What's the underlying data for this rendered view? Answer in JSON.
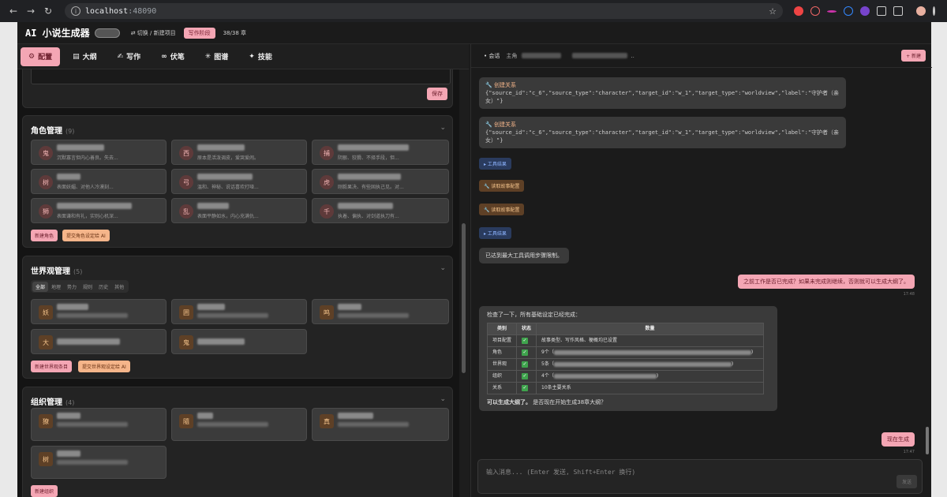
{
  "browser": {
    "url_host": "localhost",
    "url_port": ":48090"
  },
  "header": {
    "title": "AI 小说生成器",
    "switch_project": "⇄ 切换 / 新建项目",
    "phase_badge": "写作阶段",
    "chapter_count": "38/38 章"
  },
  "tabs": [
    {
      "label": "配置",
      "icon": "gear-icon"
    },
    {
      "label": "大纲",
      "icon": "outline-icon"
    },
    {
      "label": "写作",
      "icon": "pen-icon"
    },
    {
      "label": "伏笔",
      "icon": "link-icon"
    },
    {
      "label": "图谱",
      "icon": "graph-icon"
    },
    {
      "label": "技能",
      "icon": "skill-icon"
    }
  ],
  "config": {
    "save_label": "保存"
  },
  "characters": {
    "title": "角色管理",
    "count": "(9)",
    "items": [
      {
        "avatar": "鬼",
        "desc": "沉默寡言但内心善良。失去..."
      },
      {
        "avatar": "西",
        "desc": "原本是活泼调皮，爱哭爱闹。"
      },
      {
        "avatar": "捕",
        "desc": "阴狠、狡猾、不择手段，但..."
      },
      {
        "avatar": "树",
        "desc": "表面妖媚、对他人冷漠刻..."
      },
      {
        "avatar": "弓",
        "desc": "温和、神秘、说话喜欢打哑..."
      },
      {
        "avatar": "虎",
        "desc": "刚毅果决、有些固执己见。对..."
      },
      {
        "avatar": "狮",
        "desc": "表面谦和有礼，实则心机深..."
      },
      {
        "avatar": "乱",
        "desc": "表面平静如水，内心充满仇..."
      },
      {
        "avatar": "千",
        "desc": "执着、偏执、对剑道执刀有..."
      }
    ],
    "new_button": "新建角色",
    "submit_button": "提交角色设定给 AI"
  },
  "worldview": {
    "title": "世界观管理",
    "count": "(5)",
    "filters": [
      "全部",
      "地理",
      "势力",
      "规则",
      "历史",
      "其他"
    ],
    "items": [
      {
        "avatar": "妖"
      },
      {
        "avatar": "囲"
      },
      {
        "avatar": "鸣"
      },
      {
        "avatar": "大"
      },
      {
        "avatar": "鬼"
      }
    ],
    "new_button": "新建世界观条目",
    "submit_button": "提交世界观设定给 AI"
  },
  "organizations": {
    "title": "组织管理",
    "count": "(4)",
    "items": [
      {
        "avatar": "獠"
      },
      {
        "avatar": "隨"
      },
      {
        "avatar": "真"
      },
      {
        "avatar": "树"
      }
    ],
    "new_button": "新建组织"
  },
  "conversation": {
    "label": "• 会话",
    "sub": "主角",
    "suffix": "..",
    "new_button": "+ 新建",
    "messages": {
      "tool1_title": "创建关系",
      "tool1_json": "{\"source_id\":\"c_6\",\"source_type\":\"character\",\"target_id\":\"w_1\",\"target_type\":\"worldview\",\"label\":\"守护者（亲女）\"}",
      "tool2_title": "创建关系",
      "tool2_json": "{\"source_id\":\"c_6\",\"source_type\":\"character\",\"target_id\":\"w_1\",\"target_type\":\"worldview\",\"label\":\"守护者（亲女）\"}",
      "result1": "工具结果",
      "read1": "读取故事配置",
      "read2": "读取故事配置",
      "result2": "工具结果",
      "limit_msg": "已达到最大工具调用步骤限制。",
      "user1": "之前工作是否已完成？如果未完成则继续，否则就可以生成大纲了。",
      "user1_time": "17:48",
      "reply_intro": "检查了一下，所有基础设定已经完成：",
      "table": {
        "headers": [
          "类别",
          "状态",
          "数量"
        ],
        "rows": [
          {
            "cat": "项目配置",
            "qty": "故事类型、写作风格、梗概均已设置"
          },
          {
            "cat": "角色",
            "qty": "9个（"
          },
          {
            "cat": "世界观",
            "qty": "5条（"
          },
          {
            "cat": "组织",
            "qty": "4个（"
          },
          {
            "cat": "关系",
            "qty": "10条主要关系"
          }
        ],
        "check": "✓"
      },
      "reply_bold": "可以生成大纲了。",
      "reply_end": "是否现在开始生成38章大纲？",
      "user2": "现在生成",
      "user2_time": "17:47"
    }
  },
  "input": {
    "placeholder": "输入消息... (Enter 发送, Shift+Enter 换行)",
    "send_label": "发送"
  }
}
